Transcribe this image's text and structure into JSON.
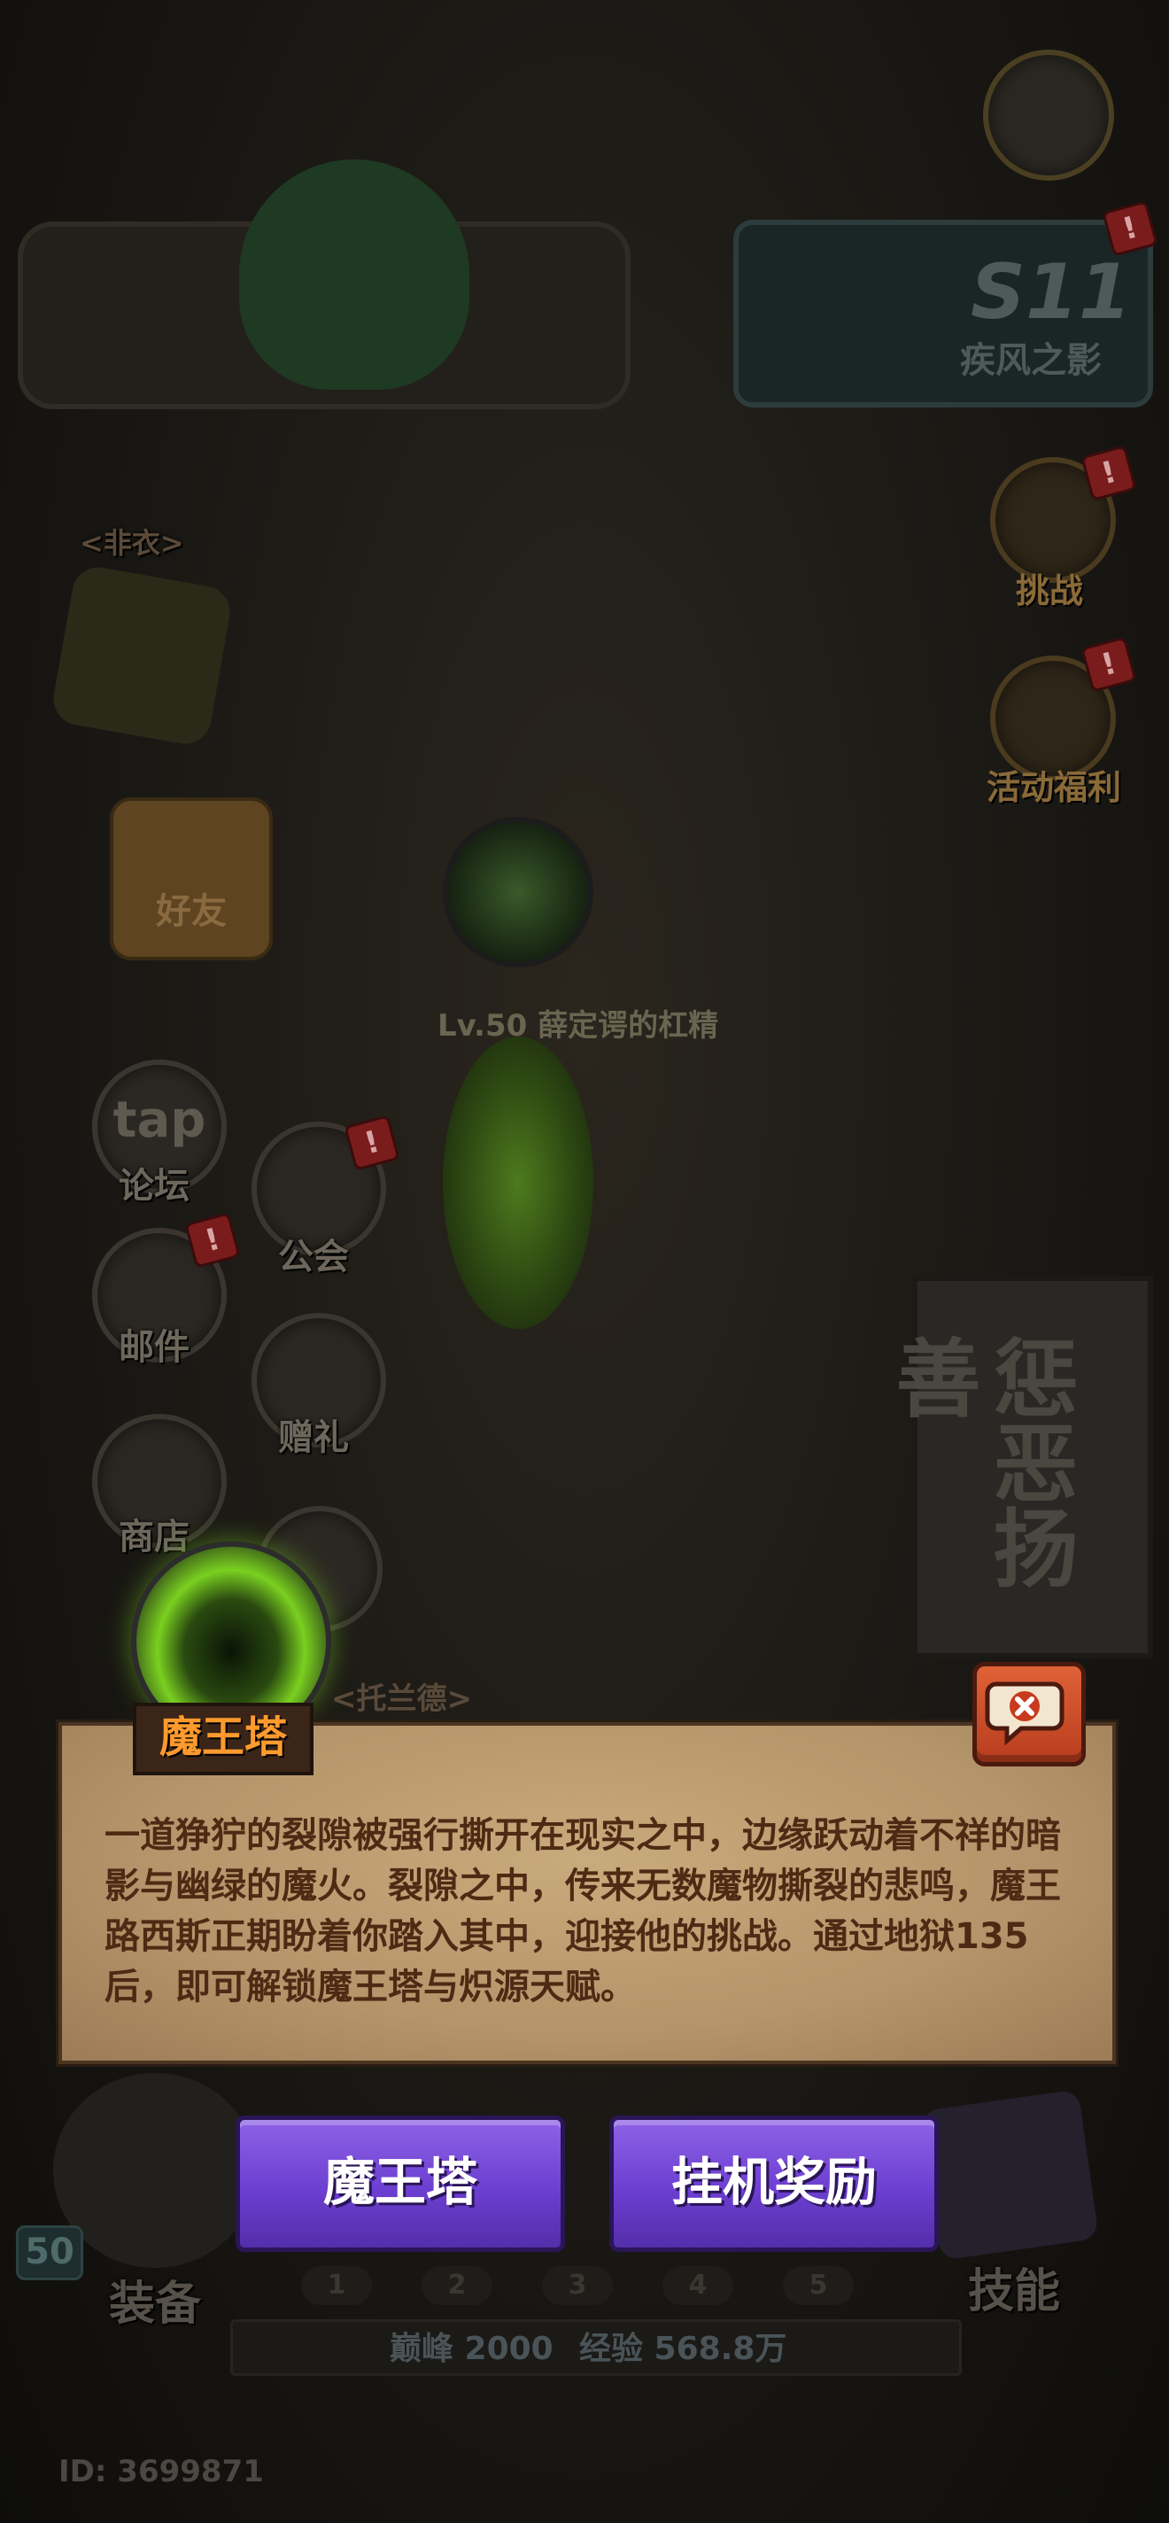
{
  "background": {
    "season_card": {
      "code": "S11",
      "name": "疾风之影"
    },
    "side_buttons": {
      "challenge": "挑战",
      "event_benefits": "活动福利",
      "friends": "好友",
      "forum_logo": "tap",
      "forum": "论坛",
      "guild": "公会",
      "mail": "邮件",
      "gift": "赠礼",
      "shop": "商店"
    },
    "npc_label": "Lv.50 薛定谔的杠精",
    "banner_text": "惩恶扬善",
    "top_left_label": "<非衣>",
    "bottom_left_label": "<托兰德>",
    "bottom_nav": {
      "equipment": "装备",
      "skills": "技能",
      "level_badge": "50",
      "slots": [
        "1",
        "2",
        "3",
        "4",
        "5"
      ],
      "peak_label": "巅峰 2000",
      "exp_label": "经验 568.8万"
    },
    "player_id": "ID: 3699871"
  },
  "popup": {
    "title": "魔王塔",
    "description": "一道狰狞的裂隙被强行撕开在现实之中，边缘跃动着不祥的暗影与幽绿的魔火。裂隙之中，传来无数魔物撕裂的悲鸣，魔王路西斯正期盼着你踏入其中，迎接他的挑战。通过地狱135后，即可解锁魔王塔与炽源天赋。",
    "close_icon": "close-speech-icon"
  },
  "buttons": {
    "demon_tower": "魔王塔",
    "idle_reward": "挂机奖励"
  },
  "colors": {
    "accent_orange": "#ff9a2e",
    "button_purple": "#6c3fd1",
    "parchment": "#b4946a",
    "close_red": "#d04a28"
  }
}
